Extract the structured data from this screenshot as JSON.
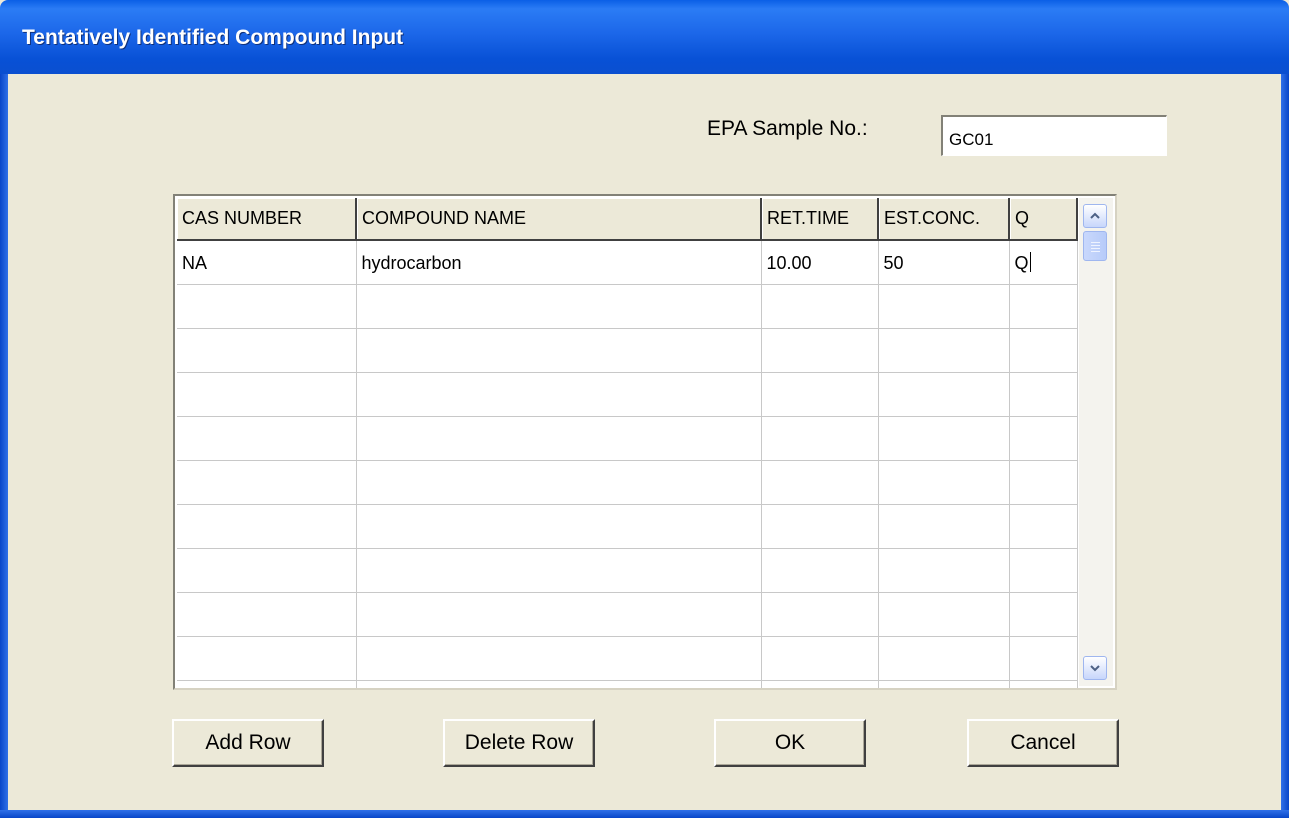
{
  "window": {
    "title": "Tentatively Identified Compound Input"
  },
  "sample": {
    "label": "EPA Sample No.:",
    "value": "GC01"
  },
  "grid": {
    "columns": [
      "CAS NUMBER",
      "COMPOUND NAME",
      "RET.TIME",
      "EST.CONC.",
      "Q"
    ],
    "rows": [
      [
        "NA",
        "hydrocarbon",
        "10.00",
        "50",
        "Q"
      ],
      [
        "",
        "",
        "",
        "",
        ""
      ],
      [
        "",
        "",
        "",
        "",
        ""
      ],
      [
        "",
        "",
        "",
        "",
        ""
      ],
      [
        "",
        "",
        "",
        "",
        ""
      ],
      [
        "",
        "",
        "",
        "",
        ""
      ],
      [
        "",
        "",
        "",
        "",
        ""
      ],
      [
        "",
        "",
        "",
        "",
        ""
      ],
      [
        "",
        "",
        "",
        "",
        ""
      ],
      [
        "",
        "",
        "",
        "",
        ""
      ],
      [
        "",
        "",
        "",
        "",
        ""
      ]
    ]
  },
  "buttons": {
    "add_row": "Add Row",
    "delete_row": "Delete Row",
    "ok": "OK",
    "cancel": "Cancel"
  },
  "colors": {
    "title_bar": "#0a5fe6",
    "dialog_bg": "#ece9d8"
  },
  "icons": {
    "scroll_up": "chevron-up-icon",
    "scroll_down": "chevron-down-icon"
  }
}
